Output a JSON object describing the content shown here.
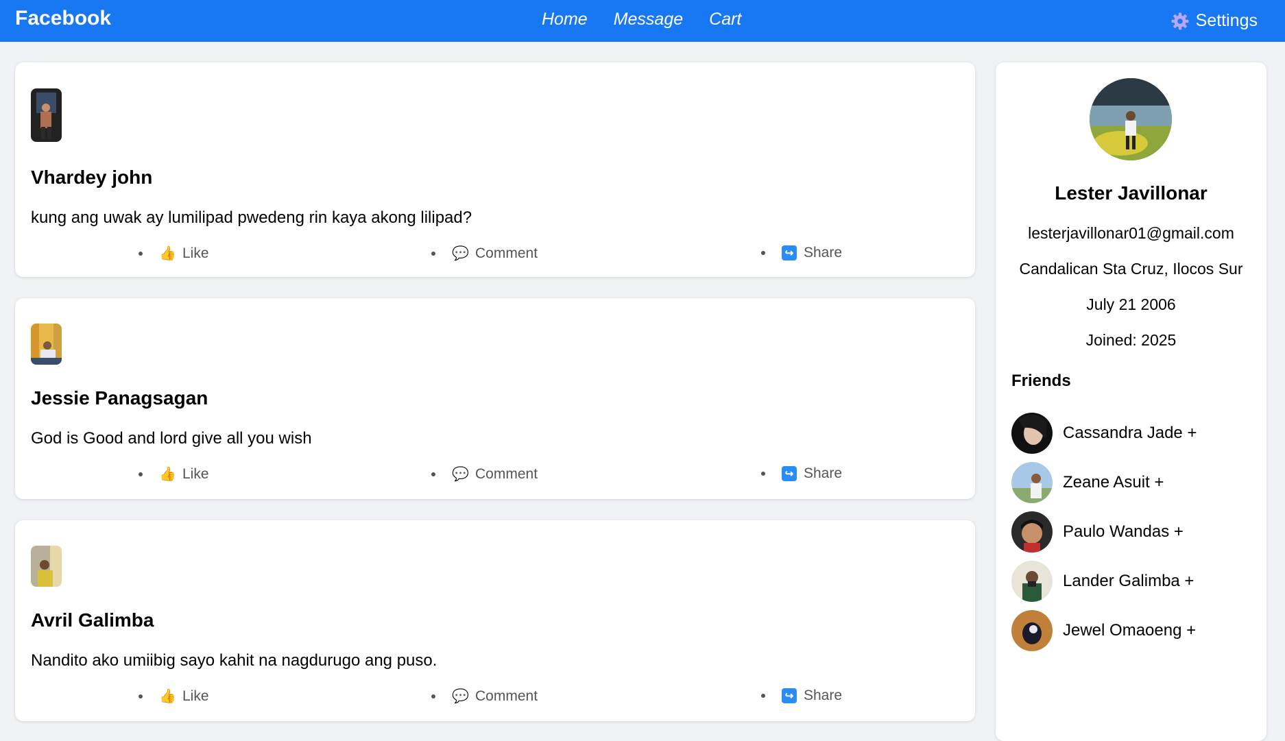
{
  "header": {
    "brand": "Facebook",
    "nav": [
      "Home",
      "Message",
      "Cart"
    ],
    "settings_label": "Settings",
    "accent": "#1877f2"
  },
  "posts": [
    {
      "author": "Vhardey john",
      "content": "kung ang uwak ay lumilipad pwedeng rin kaya akong lilipad?",
      "actions": {
        "like": "Like",
        "comment": "Comment",
        "share": "Share"
      }
    },
    {
      "author": "Jessie Panagsagan",
      "content": "God is Good and lord give all you wish",
      "actions": {
        "like": "Like",
        "comment": "Comment",
        "share": "Share"
      }
    },
    {
      "author": "Avril Galimba",
      "content": "Nandito ako umiibig sayo kahit na nagdurugo ang puso.",
      "actions": {
        "like": "Like",
        "comment": "Comment",
        "share": "Share"
      }
    }
  ],
  "profile": {
    "name": "Lester Javillonar",
    "email": "lesterjavillonar01@gmail.com",
    "address": "Candalican Sta Cruz, Ilocos Sur",
    "birthday": "July 21 2006",
    "joined": "Joined: 2025"
  },
  "friends": {
    "title": "Friends",
    "items": [
      {
        "name": "Cassandra Jade +"
      },
      {
        "name": "Zeane Asuit +"
      },
      {
        "name": "Paulo Wandas +"
      },
      {
        "name": "Lander Galimba +"
      },
      {
        "name": "Jewel Omaoeng +"
      }
    ]
  }
}
